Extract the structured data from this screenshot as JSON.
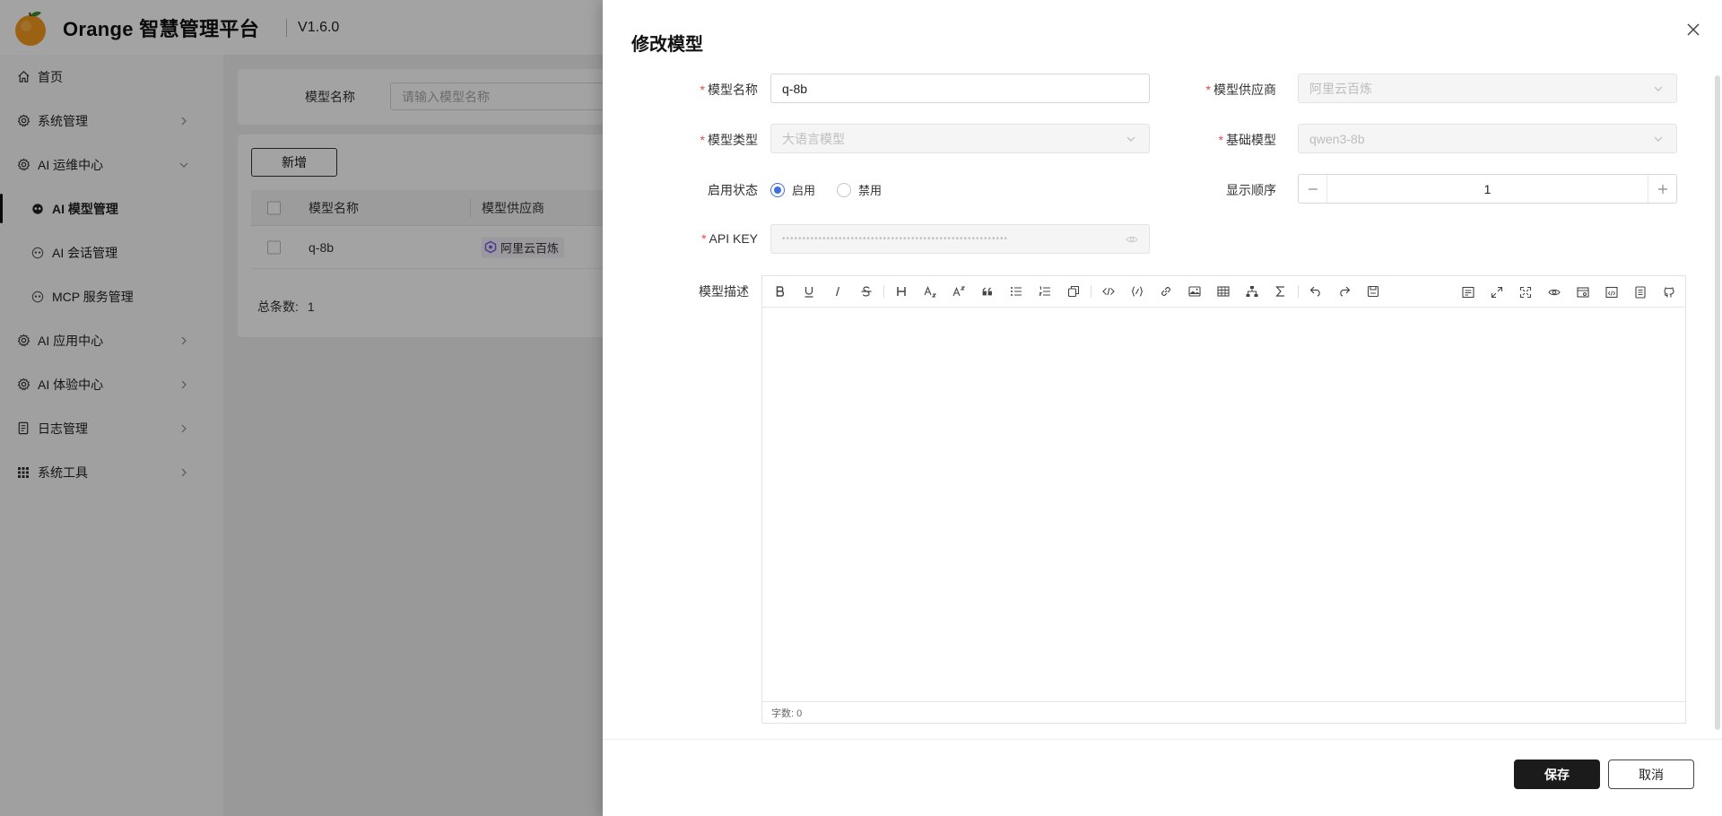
{
  "header": {
    "app_title": "Orange 智慧管理平台",
    "version": "V1.6.0"
  },
  "sidebar": {
    "items": [
      {
        "label": "首页",
        "icon": "home-icon"
      },
      {
        "label": "系统管理",
        "icon": "gear-icon"
      },
      {
        "label": "AI 运维中心",
        "icon": "gear-icon",
        "expanded": true
      },
      {
        "label": "AI 模型管理",
        "icon": "robot-icon",
        "active": true
      },
      {
        "label": "AI 会话管理",
        "icon": "robot-icon"
      },
      {
        "label": "MCP 服务管理",
        "icon": "robot-icon"
      },
      {
        "label": "AI 应用中心",
        "icon": "gear-icon"
      },
      {
        "label": "AI 体验中心",
        "icon": "gear-icon"
      },
      {
        "label": "日志管理",
        "icon": "document-icon"
      },
      {
        "label": "系统工具",
        "icon": "grid-icon"
      }
    ]
  },
  "main": {
    "search": {
      "label": "模型名称",
      "placeholder": "请输入模型名称"
    },
    "add_label": "新增",
    "table": {
      "columns": [
        "模型名称",
        "模型供应商"
      ],
      "rows": [
        {
          "name": "q-8b",
          "provider": "阿里云百炼"
        }
      ]
    },
    "total_label": "总条数:",
    "total_value": "1"
  },
  "drawer": {
    "title": "修改模型",
    "fields": {
      "model_name": {
        "label": "模型名称",
        "value": "q-8b",
        "required": true
      },
      "provider": {
        "label": "模型供应商",
        "value": "阿里云百炼",
        "required": true,
        "disabled": true
      },
      "model_type": {
        "label": "模型类型",
        "value": "大语言模型",
        "required": true,
        "disabled": true
      },
      "base_model": {
        "label": "基础模型",
        "value": "qwen3-8b",
        "required": true,
        "disabled": true
      },
      "status": {
        "label": "启用状态",
        "options": [
          "启用",
          "禁用"
        ],
        "selected": "启用"
      },
      "order": {
        "label": "显示顺序",
        "value": "1"
      },
      "api_key": {
        "label": "API KEY",
        "value": "••••••••••••••••••••••••••••••••••••••••••••••••••••••••",
        "required": true,
        "disabled": true
      },
      "description": {
        "label": "模型描述",
        "word_count": "字数: 0"
      }
    },
    "save_label": "保存",
    "cancel_label": "取消"
  },
  "colors": {
    "accent": "#3d6fe0",
    "required": "#e54848",
    "primary_button": "#1b1b1b",
    "mask": "rgba(0,0,0,0.36)"
  }
}
